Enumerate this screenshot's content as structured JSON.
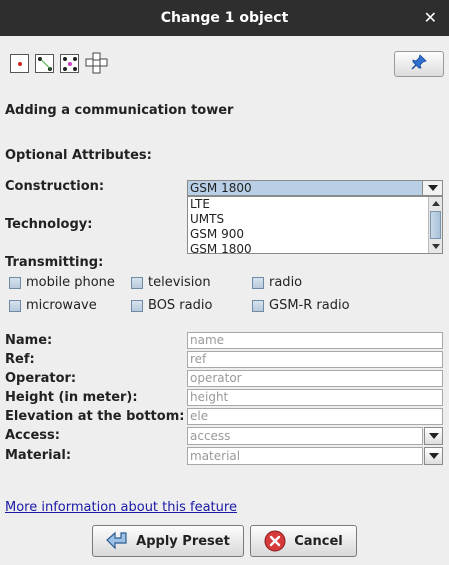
{
  "window": {
    "title": "Change 1 object",
    "close_symbol": "✕"
  },
  "toolbar": {
    "icons": [
      "node-icon",
      "way-icon",
      "closed-way-icon",
      "relation-icon",
      "pin-icon"
    ]
  },
  "heading": "Adding a communication tower",
  "optional_attributes_label": "Optional Attributes:",
  "construction": {
    "label": "Construction:",
    "value": "GSM 1800"
  },
  "technology": {
    "label": "Technology:",
    "options": [
      "LTE",
      "UMTS",
      "GSM 900",
      "GSM 1800"
    ]
  },
  "transmitting": {
    "label": "Transmitting:",
    "options": [
      "mobile phone",
      "television",
      "radio",
      "microwave",
      "BOS radio",
      "GSM-R radio"
    ]
  },
  "fields": {
    "name": {
      "label": "Name:",
      "placeholder": "name"
    },
    "ref": {
      "label": "Ref:",
      "placeholder": "ref"
    },
    "operator": {
      "label": "Operator:",
      "placeholder": "operator"
    },
    "height": {
      "label": "Height (in meter):",
      "placeholder": "height"
    },
    "elevation": {
      "label": "Elevation at the bottom:",
      "placeholder": "ele"
    },
    "access": {
      "label": "Access:",
      "placeholder": "access"
    },
    "material": {
      "label": "Material:",
      "placeholder": "material"
    }
  },
  "more_info_link": "More information about this feature",
  "buttons": {
    "apply": "Apply Preset",
    "cancel": "Cancel"
  },
  "colors": {
    "titlebar": "#2e2e2e",
    "selection": "#b8cfe5",
    "link": "#1a1aa6"
  }
}
